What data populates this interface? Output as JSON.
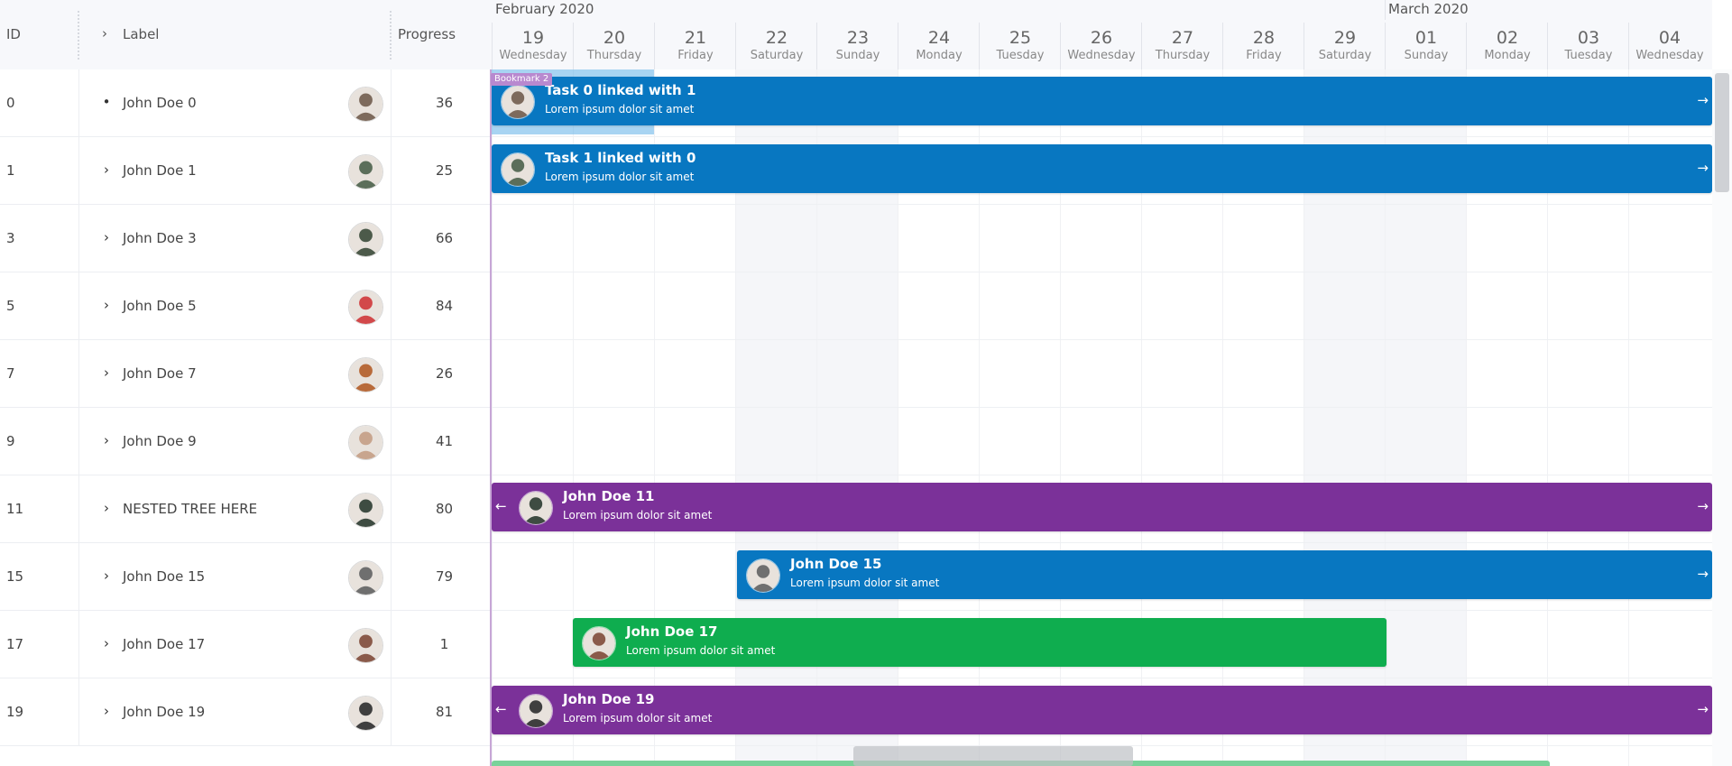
{
  "table": {
    "headers": {
      "id": "ID",
      "label": "Label",
      "progress": "Progress"
    },
    "rows": [
      {
        "id": "0",
        "toggle": "•",
        "label": "John Doe 0",
        "progress": "36",
        "avatar": "#7d6a5c"
      },
      {
        "id": "1",
        "toggle": "›",
        "label": "John Doe 1",
        "progress": "25",
        "avatar": "#5b6e5a"
      },
      {
        "id": "3",
        "toggle": "›",
        "label": "John Doe 3",
        "progress": "66",
        "avatar": "#4c5a4a"
      },
      {
        "id": "5",
        "toggle": "›",
        "label": "John Doe 5",
        "progress": "84",
        "avatar": "#d2484a"
      },
      {
        "id": "7",
        "toggle": "›",
        "label": "John Doe 7",
        "progress": "26",
        "avatar": "#b86a3a"
      },
      {
        "id": "9",
        "toggle": "›",
        "label": "John Doe 9",
        "progress": "41",
        "avatar": "#c8a58e"
      },
      {
        "id": "11",
        "toggle": "›",
        "label": "NESTED TREE HERE",
        "progress": "80",
        "avatar": "#3e4c42"
      },
      {
        "id": "15",
        "toggle": "›",
        "label": "John Doe 15",
        "progress": "79",
        "avatar": "#6f6f6f"
      },
      {
        "id": "17",
        "toggle": "›",
        "label": "John Doe 17",
        "progress": "1",
        "avatar": "#8a5a4a"
      },
      {
        "id": "19",
        "toggle": "›",
        "label": "John Doe 19",
        "progress": "81",
        "avatar": "#3f3f3f"
      }
    ]
  },
  "timeline": {
    "months": [
      {
        "label": "February 2020",
        "start_index": 0
      },
      {
        "label": "March 2020",
        "start_index": 11
      }
    ],
    "days": [
      {
        "num": "19",
        "weekday": "Wednesday",
        "weekend": false
      },
      {
        "num": "20",
        "weekday": "Thursday",
        "weekend": false
      },
      {
        "num": "21",
        "weekday": "Friday",
        "weekend": false
      },
      {
        "num": "22",
        "weekday": "Saturday",
        "weekend": true
      },
      {
        "num": "23",
        "weekday": "Sunday",
        "weekend": true
      },
      {
        "num": "24",
        "weekday": "Monday",
        "weekend": false
      },
      {
        "num": "25",
        "weekday": "Tuesday",
        "weekend": false
      },
      {
        "num": "26",
        "weekday": "Wednesday",
        "weekend": false
      },
      {
        "num": "27",
        "weekday": "Thursday",
        "weekend": false
      },
      {
        "num": "28",
        "weekday": "Friday",
        "weekend": false
      },
      {
        "num": "29",
        "weekday": "Saturday",
        "weekend": true
      },
      {
        "num": "01",
        "weekday": "Sunday",
        "weekend": true
      },
      {
        "num": "02",
        "weekday": "Monday",
        "weekend": false
      },
      {
        "num": "03",
        "weekday": "Tuesday",
        "weekend": false
      },
      {
        "num": "04",
        "weekday": "Wednesday",
        "weekend": false
      }
    ],
    "bookmark": "Bookmark 2",
    "tasks": [
      {
        "title": "Task 0 linked with 1",
        "subtitle": "Lorem ipsum dolor sit amet",
        "row": 0,
        "color": "#0877c1",
        "avatar": "#7d6a5c",
        "left_arrow": false,
        "right_arrow": true
      },
      {
        "title": "Task 1 linked with 0",
        "subtitle": "Lorem ipsum dolor sit amet",
        "row": 1,
        "color": "#0877c1",
        "avatar": "#5b6e5a",
        "left_arrow": false,
        "right_arrow": true
      },
      {
        "title": "John Doe 11",
        "subtitle": "Lorem ipsum dolor sit amet",
        "row": 6,
        "color": "#7b3199",
        "avatar": "#3e4c42",
        "left_arrow": true,
        "right_arrow": true
      },
      {
        "title": "John Doe 15",
        "subtitle": "Lorem ipsum dolor sit amet",
        "row": 7,
        "color": "#0877c1",
        "avatar": "#6f6f6f",
        "left_arrow": false,
        "right_arrow": true
      },
      {
        "title": "John Doe 17",
        "subtitle": "Lorem ipsum dolor sit amet",
        "row": 8,
        "color": "#0fad4f",
        "avatar": "#8a5a4a",
        "left_arrow": false,
        "right_arrow": false
      },
      {
        "title": "John Doe 19",
        "subtitle": "Lorem ipsum dolor sit amet",
        "row": 9,
        "color": "#7b3199",
        "avatar": "#3f3f3f",
        "left_arrow": true,
        "right_arrow": true
      }
    ],
    "arrow_right_icon": "→",
    "arrow_left_icon": "←"
  }
}
